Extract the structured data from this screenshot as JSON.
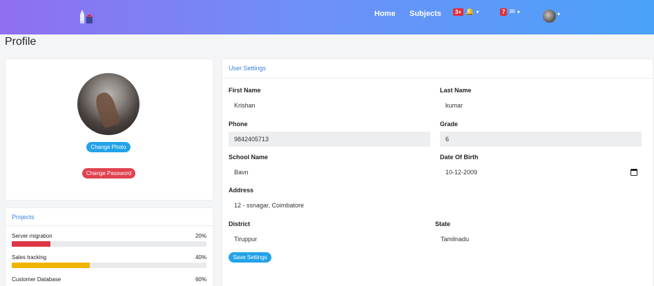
{
  "nav": {
    "links": [
      "Home",
      "Subjects"
    ],
    "notifications_count": "3+",
    "messages_count": "7",
    "caret": "▾",
    "bell_icon": "🔔",
    "mail_icon": "✉"
  },
  "page_title": "Profile",
  "profile": {
    "change_photo_label": "Change Photo",
    "change_password_label": "Change Password"
  },
  "projects": {
    "title": "Projects",
    "items": [
      {
        "name": "Server migration",
        "percent_label": "20%",
        "progress": 0.2,
        "color": "#dc3545"
      },
      {
        "name": "Sales tracking",
        "percent_label": "40%",
        "progress": 0.4,
        "color": "#f0b400"
      },
      {
        "name": "Customer Database",
        "percent_label": "60%",
        "progress": 0.6,
        "color": "#22a3e8"
      }
    ]
  },
  "settings": {
    "title": "User Settings",
    "first_name_label": "First Name",
    "first_name_value": "Krishan",
    "last_name_label": "Last Name",
    "last_name_value": "kumar",
    "phone_label": "Phone",
    "phone_value": "9842405713",
    "grade_label": "Grade",
    "grade_value": "6",
    "school_label": "School Name",
    "school_value": "Bavn",
    "dob_label": "Date Of Birth",
    "dob_value": "10-12-2009",
    "address_label": "Address",
    "address_value": "12 - ssnagar, Coimbatore",
    "district_label": "District",
    "district_value": "Tiruppur",
    "state_label": "State",
    "state_value": "Tamilnadu",
    "save_label": "Save Settings"
  }
}
